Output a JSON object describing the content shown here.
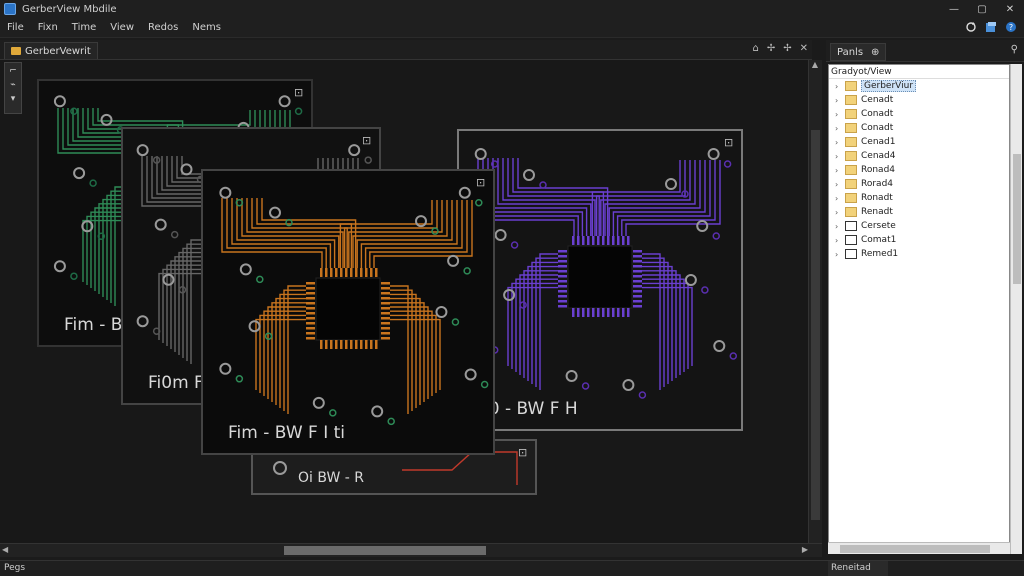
{
  "window": {
    "title": "GerberView Mbdile",
    "min": "—",
    "max": "▢",
    "close": "✕"
  },
  "menu": [
    "File",
    "Fixn",
    "Time",
    "View",
    "Redos",
    "Nems"
  ],
  "doc_tab": {
    "label": "GerberVewrit",
    "ctrls": [
      "⌂",
      "✢",
      "✢",
      "✕"
    ]
  },
  "side_tools": [
    "⌐",
    "⌁",
    "▾"
  ],
  "boards": [
    {
      "label": "Fim - BW F I H",
      "trace_color": "#2e8b57",
      "pad_color": "#1e6b46"
    },
    {
      "label": "Fim - BW F I ti",
      "trace_color": "#c8741e",
      "pad_color": "#2e8b57"
    },
    {
      "label": "l0 - BW F H",
      "trace_color": "#6a3fd0",
      "pad_color": "#5a2fb0"
    },
    {
      "label": "Fi0m F H",
      "trace_color": "#666666",
      "pad_color": "#555555"
    },
    {
      "label": "Oi  BW - R",
      "trace_color": "#c0392b",
      "pad_color": "#c0392b"
    }
  ],
  "right_panel": {
    "tab_label": "Panls",
    "tab_icon": "⊕",
    "header": "Gradyot/View",
    "items": [
      {
        "label": "GerberViur",
        "icon": "folder",
        "selected": true
      },
      {
        "label": "Cenadt",
        "icon": "folder",
        "selected": false
      },
      {
        "label": "Conadt",
        "icon": "folder",
        "selected": false
      },
      {
        "label": "Conadt",
        "icon": "folder",
        "selected": false
      },
      {
        "label": "Cenad1",
        "icon": "folder",
        "selected": false
      },
      {
        "label": "Cenad4",
        "icon": "folder",
        "selected": false
      },
      {
        "label": "Ronad4",
        "icon": "folder",
        "selected": false
      },
      {
        "label": "Rorad4",
        "icon": "folder",
        "selected": false
      },
      {
        "label": "Ronadt",
        "icon": "folder",
        "selected": false
      },
      {
        "label": "Renadt",
        "icon": "folder",
        "selected": false
      },
      {
        "label": "Cersete",
        "icon": "doc",
        "selected": false
      },
      {
        "label": "Comat1",
        "icon": "doc",
        "selected": false
      },
      {
        "label": "Remed1",
        "icon": "doc",
        "selected": false
      }
    ]
  },
  "status": {
    "left": "Pegs",
    "right": "Reneitad"
  }
}
